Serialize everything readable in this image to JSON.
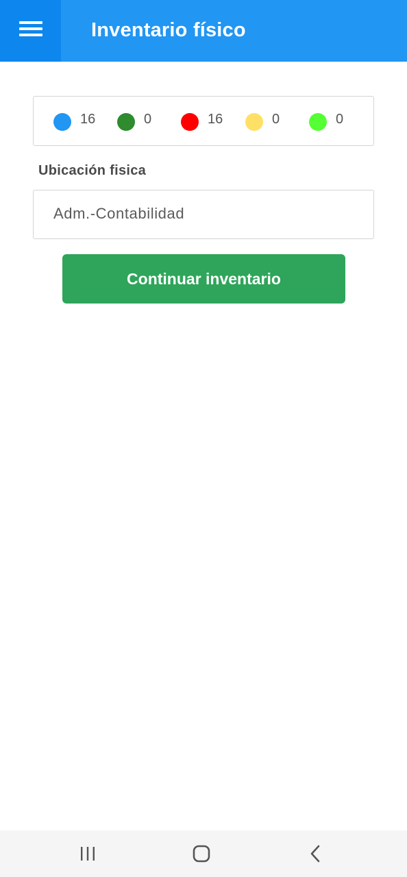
{
  "header": {
    "title": "Inventario físico",
    "menu_icon": "hamburger-menu-icon",
    "background_color": "#2196f3",
    "menu_background_color": "#0d87ee"
  },
  "status_summary": [
    {
      "color": "#2196f3",
      "count": "16"
    },
    {
      "color": "#2e8b2e",
      "count": "0"
    },
    {
      "color": "#ff0000",
      "count": "16"
    },
    {
      "color": "#ffe066",
      "count": "0"
    },
    {
      "color": "#55ff33",
      "count": "0"
    }
  ],
  "location": {
    "label": "Ubicación fisica",
    "value": "Adm.-Contabilidad"
  },
  "continue_button": {
    "label": "Continuar inventario",
    "color": "#2ea55a"
  },
  "system_nav": {
    "recents_icon": "recent-apps-icon",
    "home_icon": "home-icon",
    "back_icon": "back-chevron-icon"
  }
}
